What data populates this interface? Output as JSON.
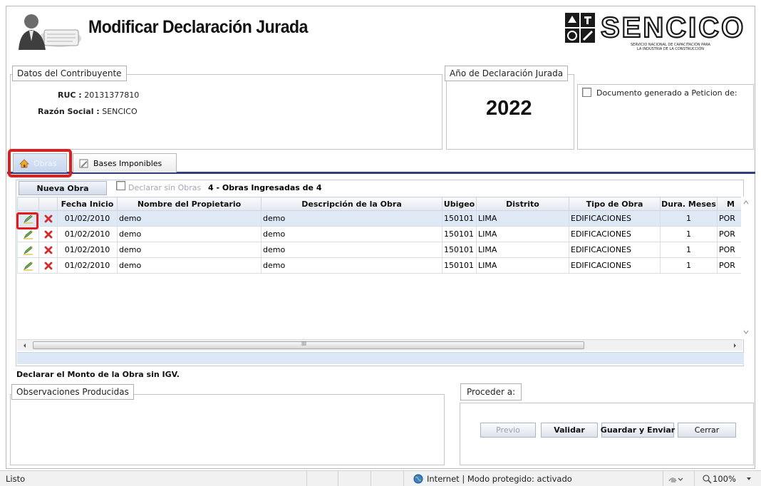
{
  "header": {
    "title": "Modificar Declaración Jurada",
    "logo_text": "SENCICO",
    "logo_subtitle_1": "SERVICIO NACIONAL DE CAPACITACIÓN PARA",
    "logo_subtitle_2": "LA INDUSTRIA DE LA CONSTRUCCIÓN"
  },
  "contribuyente": {
    "legend": "Datos del Contribuyente",
    "ruc_label": "RUC :",
    "ruc_value": "20131377810",
    "razon_label": "Razón Social :",
    "razon_value": "SENCICO"
  },
  "anio": {
    "legend": "Año de Declaración Jurada",
    "value": "2022"
  },
  "documento": {
    "label": "Documento generado a Peticion de:"
  },
  "tabs": [
    {
      "label": "Obras",
      "icon": "home-icon"
    },
    {
      "label": "Bases Imponibles",
      "icon": "edit-icon"
    }
  ],
  "grid_toolbar": {
    "new_button": "Nueva Obra",
    "declarar_sin_obras": "Declarar sin Obras",
    "count_text": "4 - Obras Ingresadas de 4"
  },
  "grid": {
    "columns": [
      "Fecha Inicio",
      "Nombre del Propietario",
      "Descripción de la Obra",
      "Ubigeo",
      "Distrito",
      "Tipo de Obra",
      "Dura. Meses",
      "M"
    ],
    "rows": [
      {
        "fecha": "01/02/2010",
        "propietario": "demo",
        "descripcion": "demo",
        "ubigeo": "150101",
        "distrito": "LIMA",
        "tipo": "EDIFICACIONES",
        "meses": "1",
        "m": "POR"
      },
      {
        "fecha": "01/02/2010",
        "propietario": "demo",
        "descripcion": "demo",
        "ubigeo": "150101",
        "distrito": "LIMA",
        "tipo": "EDIFICACIONES",
        "meses": "1",
        "m": "POR"
      },
      {
        "fecha": "01/02/2010",
        "propietario": "demo",
        "descripcion": "demo",
        "ubigeo": "150101",
        "distrito": "LIMA",
        "tipo": "EDIFICACIONES",
        "meses": "1",
        "m": "POR"
      },
      {
        "fecha": "01/02/2010",
        "propietario": "demo",
        "descripcion": "demo",
        "ubigeo": "150101",
        "distrito": "LIMA",
        "tipo": "EDIFICACIONES",
        "meses": "1",
        "m": "POR"
      }
    ],
    "hscroll_mark": "III"
  },
  "note": "Declarar el Monto de la Obra sin IGV.",
  "observaciones": {
    "legend": "Observaciones Producidas"
  },
  "proceder": {
    "legend": "Proceder a:",
    "buttons": {
      "previo": "Previo",
      "validar": "Validar",
      "guardar": "Guardar y Enviar",
      "cerrar": "Cerrar"
    }
  },
  "statusbar": {
    "left": "Listo",
    "zone": "Internet | Modo protegido: activado",
    "zoom": "100%"
  },
  "colors": {
    "tab_line": "#2e3f7a",
    "highlight_red": "#e21b1b",
    "selected_row": "#dfe8f5"
  }
}
